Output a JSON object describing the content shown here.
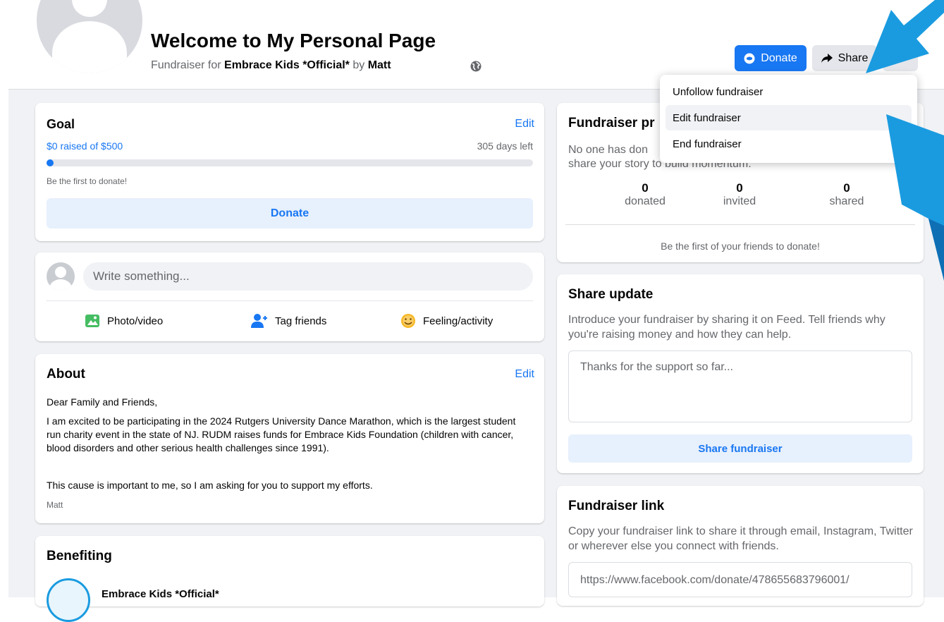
{
  "header": {
    "title": "Welcome to My Personal Page",
    "subtitle_prefix": "Fundraiser for ",
    "organization": "Embrace Kids *Official*",
    "subtitle_by": " by ",
    "author": "Matt",
    "donate_label": "Donate",
    "share_label": "Share",
    "more_label": "···"
  },
  "menu": {
    "items": [
      "Unfollow fundraiser",
      "Edit fundraiser",
      "End fundraiser"
    ]
  },
  "goal": {
    "heading": "Goal",
    "edit_label": "Edit",
    "raised_text": "$0 raised of $500",
    "days_left": "305 days left",
    "progress_fraction": 0,
    "first_text": "Be the first to donate!",
    "donate_label": "Donate"
  },
  "composer": {
    "placeholder": "Write something...",
    "photo_label": "Photo/video",
    "tag_label": "Tag friends",
    "feeling_label": "Feeling/activity"
  },
  "about": {
    "heading": "About",
    "edit_label": "Edit",
    "greeting": "Dear Family and Friends,",
    "paragraph1": "I am excited to be participating in the 2024 Rutgers University Dance Marathon, which is the largest student run charity event in the state of NJ. RUDM raises funds for Embrace Kids Foundation (children with cancer, blood disorders and other serious health challenges since 1991).",
    "paragraph2": "This cause is important to me, so I am asking for you to support my efforts.",
    "signature": "Matt"
  },
  "benefiting": {
    "heading": "Benefiting",
    "org_name": "Embrace Kids *Official*"
  },
  "progress_card": {
    "heading": "Fundraiser pr",
    "desc_line1": "No one has don",
    "desc_line2": "share your story to build momentum.",
    "stats": [
      {
        "value": "0",
        "label": "donated"
      },
      {
        "value": "0",
        "label": "invited"
      },
      {
        "value": "0",
        "label": "shared"
      }
    ],
    "friends_text": "Be the first of your friends to donate!"
  },
  "share_update": {
    "heading": "Share update",
    "desc": "Introduce your fundraiser by sharing it on Feed. Tell friends why you're raising money and how they can help.",
    "placeholder": "Thanks for the support so far...",
    "button_label": "Share fundraiser"
  },
  "link_card": {
    "heading": "Fundraiser link",
    "desc": "Copy your fundraiser link to share it through email, Instagram, Twitter or wherever else you connect with friends.",
    "url": "https://www.facebook.com/donate/478655683796001/"
  },
  "colors": {
    "accent": "#1877f2",
    "arrow": "#1a9be0"
  }
}
